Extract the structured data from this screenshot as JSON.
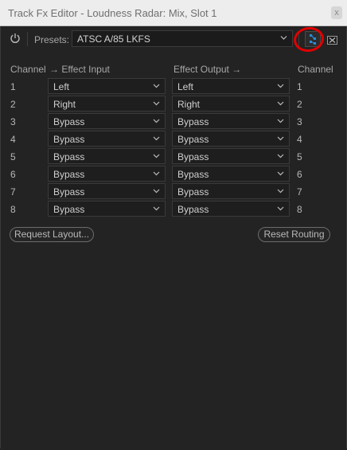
{
  "window": {
    "title": "Track Fx Editor - Loudness Radar: Mix, Slot 1",
    "close_label": "x"
  },
  "toolbar": {
    "presets_label": "Presets:",
    "preset_value": "ATSC A/85 LKFS"
  },
  "headers": {
    "channel_left": "Channel",
    "effect_input": "→ Effect Input",
    "effect_output": "Effect Output →",
    "channel_right": "Channel"
  },
  "rows": [
    {
      "channel": "1",
      "input": "Left",
      "output": "Left",
      "out_channel": "1"
    },
    {
      "channel": "2",
      "input": "Right",
      "output": "Right",
      "out_channel": "2"
    },
    {
      "channel": "3",
      "input": "Bypass",
      "output": "Bypass",
      "out_channel": "3"
    },
    {
      "channel": "4",
      "input": "Bypass",
      "output": "Bypass",
      "out_channel": "4"
    },
    {
      "channel": "5",
      "input": "Bypass",
      "output": "Bypass",
      "out_channel": "5"
    },
    {
      "channel": "6",
      "input": "Bypass",
      "output": "Bypass",
      "out_channel": "6"
    },
    {
      "channel": "7",
      "input": "Bypass",
      "output": "Bypass",
      "out_channel": "7"
    },
    {
      "channel": "8",
      "input": "Bypass",
      "output": "Bypass",
      "out_channel": "8"
    }
  ],
  "buttons": {
    "request_layout": "Request Layout...",
    "reset_routing": "Reset Routing"
  },
  "colors": {
    "background": "#232323",
    "accent": "#2d8ad8",
    "highlight": "#e00000"
  }
}
